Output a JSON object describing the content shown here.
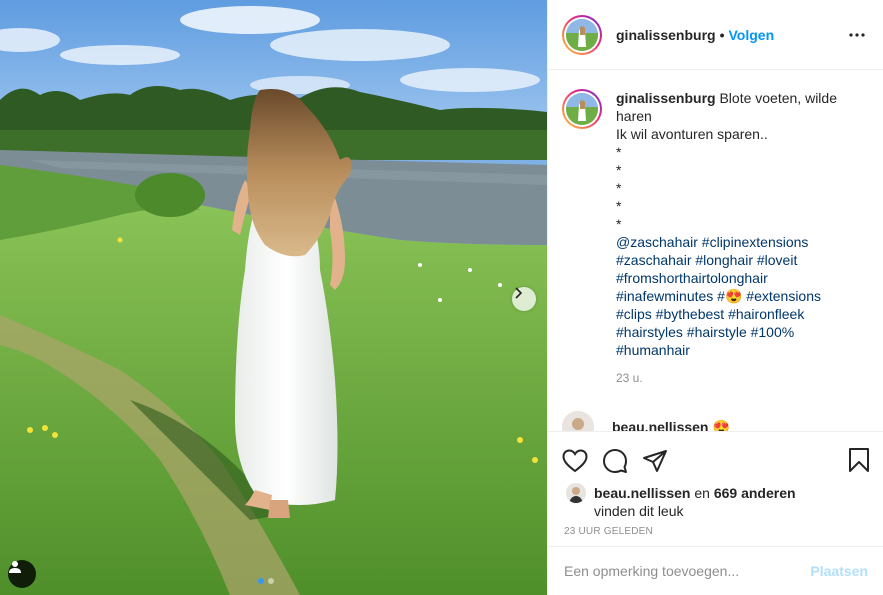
{
  "post": {
    "username": "ginalissenburg",
    "separator": "•",
    "follow_label": "Volgen"
  },
  "caption": {
    "username": "ginalissenburg",
    "line1": "Blote voeten, wilde haren",
    "line2": "Ik wil avonturen sparen..",
    "stars": [
      "*",
      "*",
      "*",
      "*",
      "*"
    ],
    "hashtags_lines": [
      "@zaschahair #clipinextensions",
      "#zaschahair #longhair #loveit",
      "#fromshorthairtolonghair",
      "#inafewminutes #",
      "#clips #bythebest #haironfleek",
      "#hairstyles #hairstyle #100%",
      "#humanhair"
    ],
    "emoji_after_line4": "😍",
    "line4_tail": " #extensions",
    "time": "23 u."
  },
  "comment_preview": {
    "username": "beau.nellissen",
    "emoji": "😍"
  },
  "likes": {
    "user": "beau.nellissen",
    "connector": " en ",
    "count": "669 anderen",
    "tail": "vinden dit leuk"
  },
  "date_label": "23 UUR GELEDEN",
  "comment_input": {
    "placeholder": "Een opmerking toevoegen...",
    "post_label": "Plaatsen"
  },
  "colors": {
    "link_blue": "#0095f6",
    "hashtag": "#00376b",
    "muted": "#8e8e8e",
    "post_disabled": "#b2dffc"
  },
  "icons": [
    "more-options-icon",
    "heart-icon",
    "comment-icon",
    "share-icon",
    "bookmark-icon",
    "next-arrow-icon",
    "user-tag-icon"
  ]
}
